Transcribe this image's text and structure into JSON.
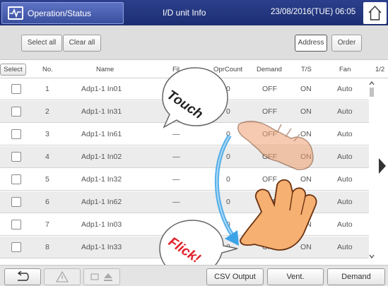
{
  "header": {
    "tab_label": "Operation/Status",
    "title": "I/D unit Info",
    "datetime": "23/08/2016(TUE) 06:05"
  },
  "toolbar": {
    "select_all": "Select all",
    "clear_all": "Clear all",
    "address": "Address",
    "order": "Order"
  },
  "columns": {
    "select": "Select",
    "no": "No.",
    "name": "Name",
    "filter": "Fil",
    "oprcount": "OprCount",
    "demand": "Demand",
    "ts": "T/S",
    "fan": "Fan",
    "page": "1/2"
  },
  "rows": [
    {
      "no": "1",
      "name": "Adp1-1 In01",
      "filter": "",
      "oprcount": "0",
      "demand": "OFF",
      "ts": "ON",
      "fan": "Auto"
    },
    {
      "no": "2",
      "name": "Adp1-1 In31",
      "filter": "",
      "oprcount": "0",
      "demand": "OFF",
      "ts": "ON",
      "fan": "Auto"
    },
    {
      "no": "3",
      "name": "Adp1-1 In61",
      "filter": "—",
      "oprcount": "0",
      "demand": "OFF",
      "ts": "ON",
      "fan": "Auto"
    },
    {
      "no": "4",
      "name": "Adp1-1 In02",
      "filter": "—",
      "oprcount": "0",
      "demand": "OFF",
      "ts": "ON",
      "fan": "Auto"
    },
    {
      "no": "5",
      "name": "Adp1-1 In32",
      "filter": "—",
      "oprcount": "0",
      "demand": "OFF",
      "ts": "ON",
      "fan": "Auto"
    },
    {
      "no": "6",
      "name": "Adp1-1 In62",
      "filter": "—",
      "oprcount": "0",
      "demand": "OFF",
      "ts": "ON",
      "fan": "Auto"
    },
    {
      "no": "7",
      "name": "Adp1-1 In03",
      "filter": "",
      "oprcount": "0",
      "demand": "OFF",
      "ts": "ON",
      "fan": "Auto"
    },
    {
      "no": "8",
      "name": "Adp1-1 In33",
      "filter": "",
      "oprcount": "0",
      "demand": "OFF",
      "ts": "ON",
      "fan": "Auto"
    }
  ],
  "annotations": {
    "touch": "Touch",
    "flick": "Flick!"
  },
  "footer": {
    "csv_output": "CSV Output",
    "vent": "Vent.",
    "demand": "Demand"
  },
  "icons": {
    "header_tab": "waveform-icon",
    "home": "home-icon",
    "back": "back-arrow-icon",
    "warning": "warning-icon",
    "eject": "eject-icon",
    "next_page": "next-page-arrow-icon"
  },
  "colors": {
    "header": "#22357e",
    "flick_text": "#e0202a",
    "arrow": "#3ba3e6",
    "hand": "#f5b072"
  }
}
